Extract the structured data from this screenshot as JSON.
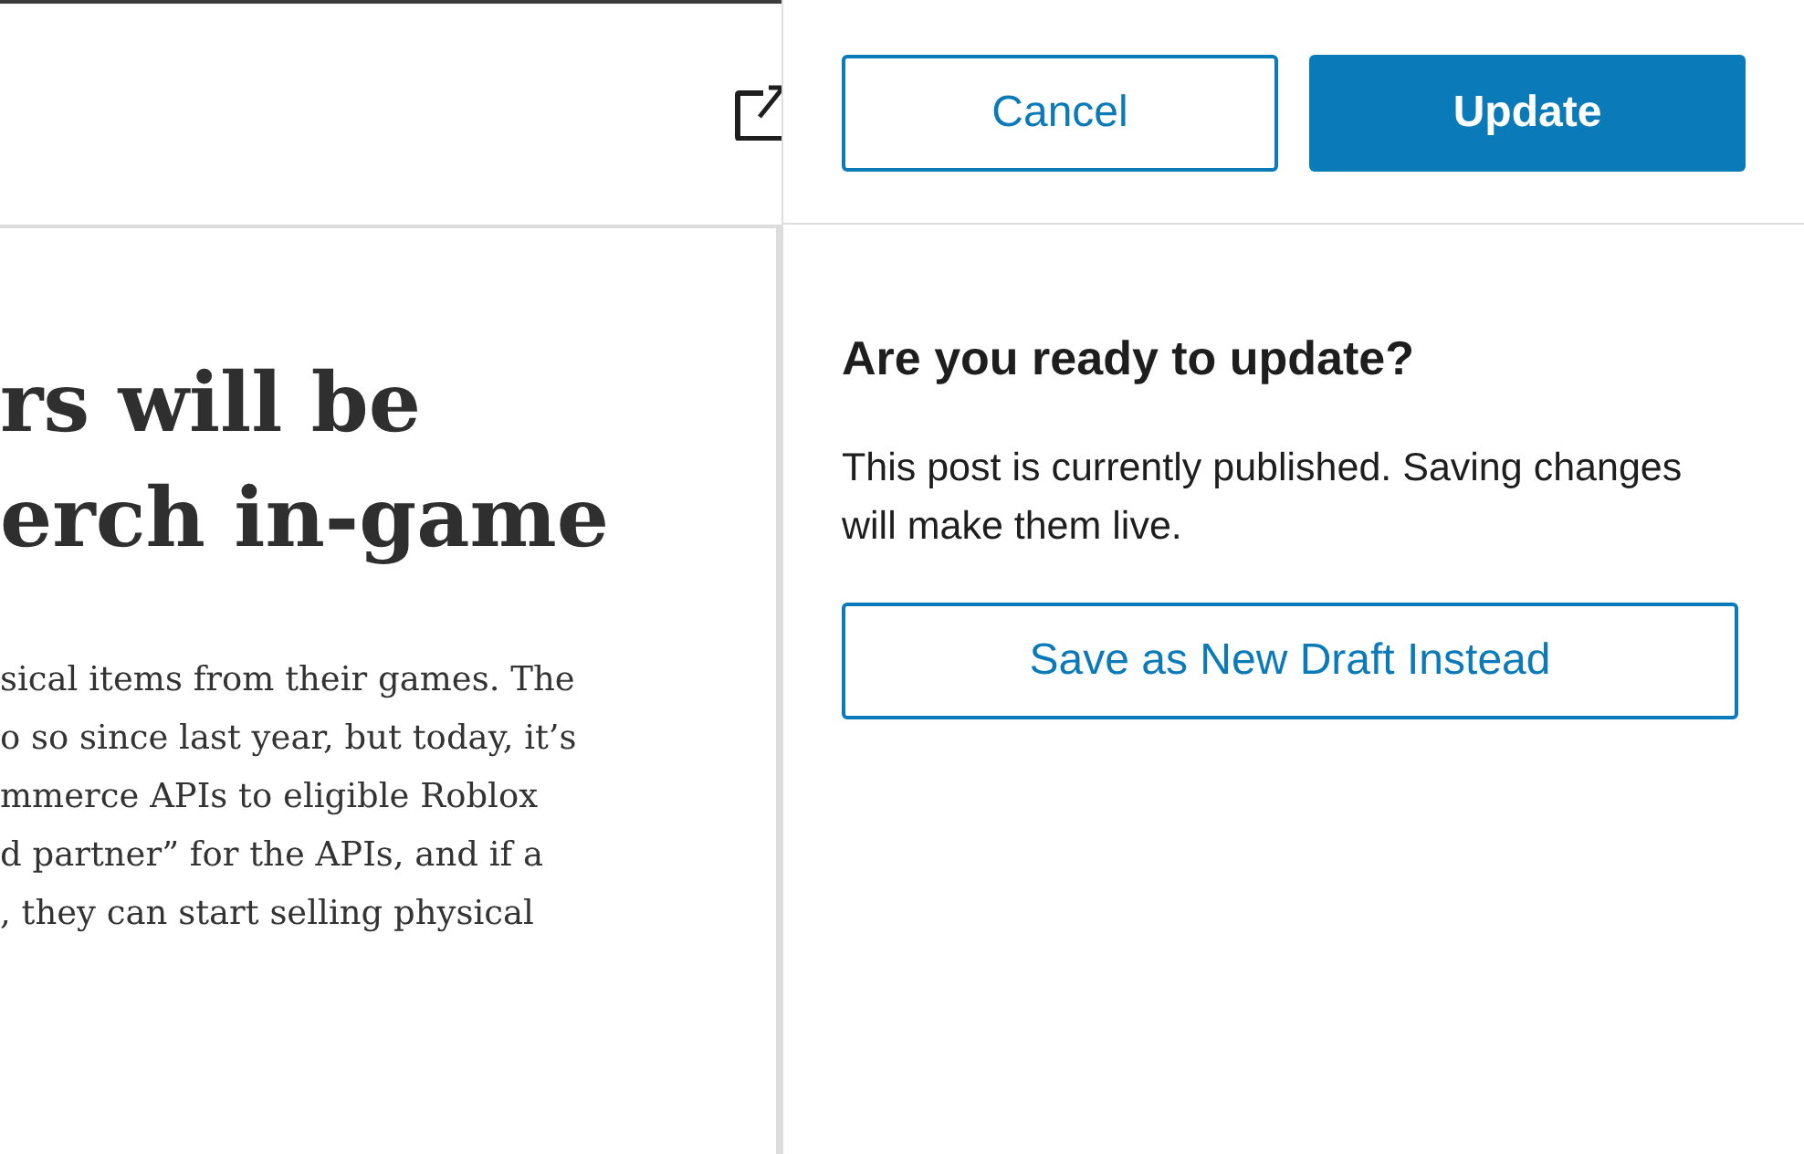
{
  "editor": {
    "heading_lines": [
      "rs will be",
      "erch in-game"
    ],
    "paragraph_lines": [
      "sical items from their games. The",
      "o so since last year, but today, it’s",
      "mmerce APIs to eligible Roblox",
      "d partner” for the APIs, and if a",
      ", they can start selling physical"
    ]
  },
  "publish_panel": {
    "buttons": [
      {
        "label": "Cancel",
        "kind": "secondary"
      },
      {
        "label": "Update",
        "kind": "primary"
      }
    ],
    "title": "Are you ready to update?",
    "description": "This post is currently published. Saving changes will make them live.",
    "draft_button": "Save as New Draft Instead"
  }
}
